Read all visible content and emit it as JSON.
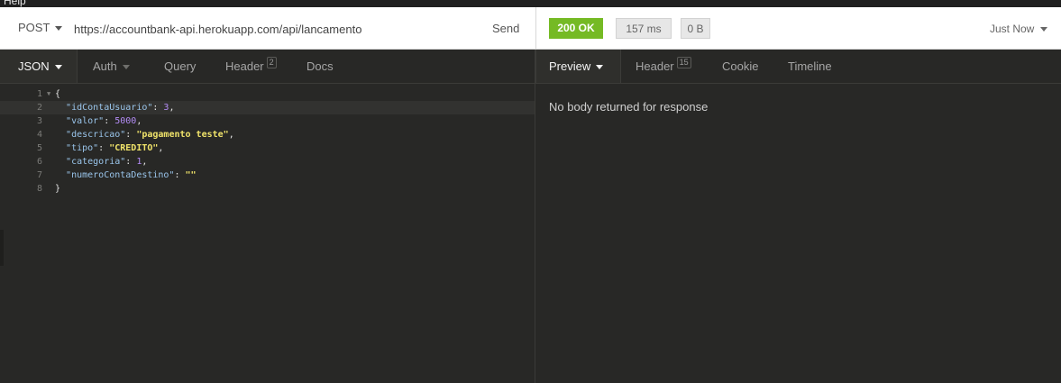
{
  "menubar": {
    "partial_label": "Help"
  },
  "request": {
    "method": "POST",
    "url": "https://accountbank-api.herokuapp.com/api/lancamento",
    "send_label": "Send",
    "tabs": [
      {
        "label": "JSON",
        "active": true
      },
      {
        "label": "Auth"
      },
      {
        "label": "Query"
      },
      {
        "label": "Header",
        "count": "2"
      },
      {
        "label": "Docs"
      }
    ],
    "body_lines": [
      {
        "num": "1",
        "fold": "▼",
        "open": "{"
      },
      {
        "num": "2",
        "key": "\"idContaUsuario\"",
        "sep": ": ",
        "val": "3",
        "val_type": "num",
        "end": ","
      },
      {
        "num": "3",
        "key": "\"valor\"",
        "sep": ": ",
        "val": "5000",
        "val_type": "num",
        "end": ","
      },
      {
        "num": "4",
        "key": "\"descricao\"",
        "sep": ": ",
        "val": "\"pagamento teste\"",
        "val_type": "str",
        "end": ","
      },
      {
        "num": "5",
        "key": "\"tipo\"",
        "sep": ": ",
        "val": "\"CREDITO\"",
        "val_type": "str",
        "end": ","
      },
      {
        "num": "6",
        "key": "\"categoria\"",
        "sep": ": ",
        "val": "1",
        "val_type": "num",
        "end": ","
      },
      {
        "num": "7",
        "key": "\"numeroContaDestino\"",
        "sep": ": ",
        "val": "\"\"",
        "val_type": "str",
        "end": ""
      },
      {
        "num": "8",
        "close": "}"
      }
    ]
  },
  "response": {
    "status": "200 OK",
    "time": "157 ms",
    "size": "0 B",
    "history_label": "Just Now",
    "tabs": [
      {
        "label": "Preview",
        "active": true
      },
      {
        "label": "Header",
        "count": "15"
      },
      {
        "label": "Cookie"
      },
      {
        "label": "Timeline"
      }
    ],
    "body_message": "No body returned for response"
  },
  "colors": {
    "status_ok": "#75ba24",
    "editor_bg": "#282826",
    "json_key": "#9ac5eb",
    "json_number": "#b38cf5",
    "json_string": "#f0e36a"
  }
}
